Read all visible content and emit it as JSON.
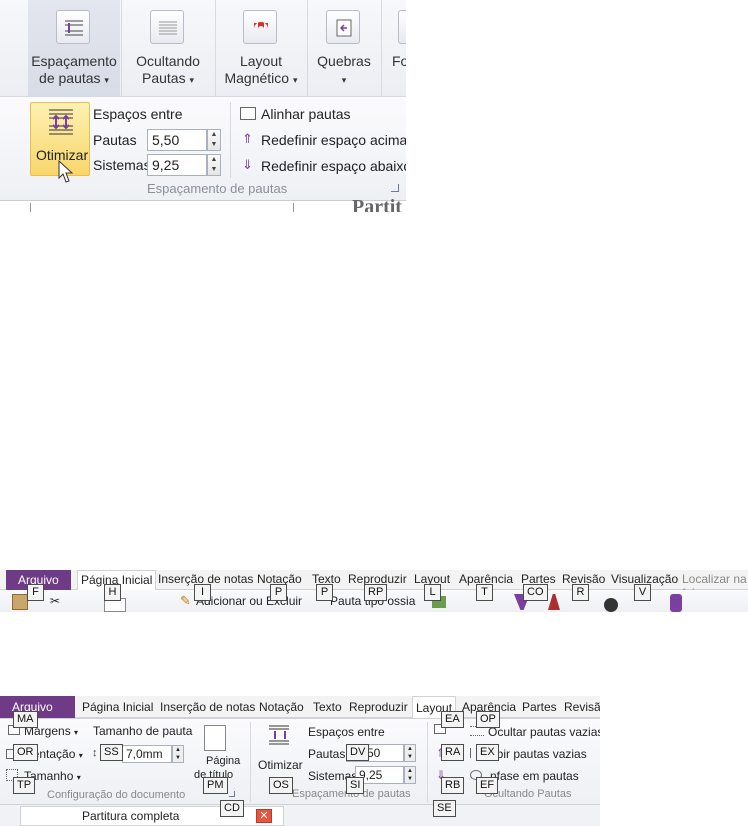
{
  "zoom_ribbon": {
    "buttons": [
      {
        "label1": "Espaçamento",
        "label2": "de pautas",
        "icon": "staff-spacing-icon"
      },
      {
        "label1": "Ocultando",
        "label2": "Pautas",
        "icon": "hide-staves-icon"
      },
      {
        "label1": "Layout",
        "label2": "Magnético",
        "icon": "magnet-icon"
      },
      {
        "label1": "Quebras",
        "label2": "",
        "icon": "break-icon"
      },
      {
        "label1": "Fo",
        "label2": "",
        "icon": "format-icon"
      }
    ],
    "otimizar_label": "Otimizar",
    "espacos_entre": "Espaços entre",
    "pautas_label": "Pautas",
    "pautas_value": "5,50",
    "sistemas_label": "Sistemas",
    "sistemas_value": "9,25",
    "alinhar": "Alinhar pautas",
    "redef_acima": "Redefinir espaço acima",
    "redef_abaixo": "Redefinir espaço abaixo",
    "group_name": "Espaçamento de pautas",
    "doc_fragment": "Partit"
  },
  "strip": {
    "tabs": [
      "Arquivo",
      "Página Inicial",
      "Inserção de notas",
      "Notação",
      "Texto",
      "Reproduzir",
      "Layout",
      "Aparência",
      "Partes",
      "Revisão",
      "Visualização"
    ],
    "search_placeholder": "Localizar na faixa",
    "cmd_adicionar": "Adicionar ou Excluir",
    "cmd_ossia": "Pauta tipo ossia",
    "keytips": [
      "F",
      "H",
      "I",
      "P",
      "P",
      "RP",
      "L",
      "T",
      "CO",
      "R",
      "V"
    ]
  },
  "layout_ribbon": {
    "tabs": [
      "Arquivo",
      "Página Inicial",
      "Inserção de notas",
      "Notação",
      "Texto",
      "Reproduzir",
      "Layout",
      "Aparência",
      "Partes",
      "Revisã"
    ],
    "margens": "Margens",
    "orientacao": "rientação",
    "tamanho": "Tamanho",
    "tamanho_pauta": "Tamanho de pauta",
    "tamanho_pauta_value": "7,0mm",
    "pagina_titulo_1": "Página",
    "pagina_titulo_2": "de título",
    "config_group": "Configuração do documento",
    "otimizar": "Otimizar",
    "espacos_entre": "Espaços entre",
    "pautas_label": "Pautas",
    "pautas_value": "50",
    "sistemas_label": "Sistemas",
    "sistemas_value": "9,25",
    "espacamento_group": "Espaçamento de pautas",
    "ocultar_vazias": "Ocultar pautas vazias",
    "exibir_vazias": "ibir pautas vazias",
    "enfase": "nfase em pautas",
    "ocultando_group": "Ocultando Pautas",
    "doc_tab": "Partitura completa",
    "keytips": {
      "ma": "MA",
      "or": "OR",
      "tp": "TP",
      "ss": "SS",
      "pm": "PM",
      "cd": "CD",
      "os": "OS",
      "dv": "DV",
      "si": "SI",
      "ea": "EA",
      "ra": "RA",
      "rb": "RB",
      "se": "SE",
      "op": "OP",
      "ex": "EX",
      "ef": "EF"
    }
  },
  "colors": {
    "file_tab": "#6f3a86",
    "highlight": "#f8d66b",
    "close": "#e8553e"
  }
}
